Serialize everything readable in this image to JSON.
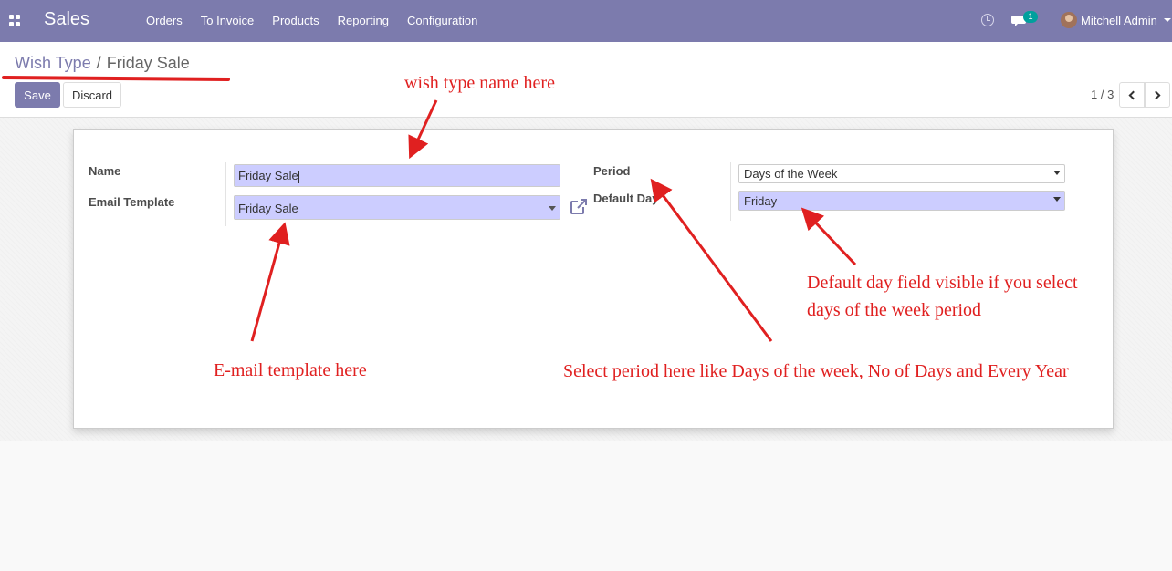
{
  "navbar": {
    "brand": "Sales",
    "menu": [
      "Orders",
      "To Invoice",
      "Products",
      "Reporting",
      "Configuration"
    ],
    "chat_badge": "1",
    "user_name": "Mitchell Admin"
  },
  "breadcrumb": {
    "parent": "Wish Type",
    "separator": "/",
    "current": "Friday Sale"
  },
  "toolbar": {
    "save_label": "Save",
    "discard_label": "Discard"
  },
  "pager": {
    "value": "1 / 3"
  },
  "form": {
    "name_label": "Name",
    "name_value": "Friday Sale",
    "email_template_label": "Email Template",
    "email_template_value": "Friday Sale",
    "period_label": "Period",
    "period_value": "Days of the Week",
    "default_day_label": "Default Day",
    "default_day_value": "Friday"
  },
  "annotations": {
    "wish_type": "wish type name here",
    "email_template": "E-mail template here",
    "default_day_line1": "Default day field visible if you select",
    "default_day_line2": "days of the week period",
    "period": "Select period here like Days of the week, No of Days and Every Year"
  },
  "colors": {
    "brand": "#7c7bad",
    "required_field": "#cccdff",
    "annotation": "#e02020",
    "badge": "#00a09d"
  }
}
